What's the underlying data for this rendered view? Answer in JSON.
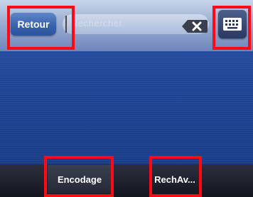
{
  "top_bar": {
    "back_label": "Retour",
    "search_placeholder": "Rechercher",
    "clear_icon": "backspace-clear-icon",
    "keyboard_icon": "keyboard-icon"
  },
  "bottom_bar": {
    "tabs": [
      {
        "label": "Encodage"
      },
      {
        "label": "RechAv..."
      }
    ]
  },
  "colors": {
    "highlight": "#ff0a14",
    "background": "#1f4494",
    "bottom_bar": "#1a1d27"
  }
}
